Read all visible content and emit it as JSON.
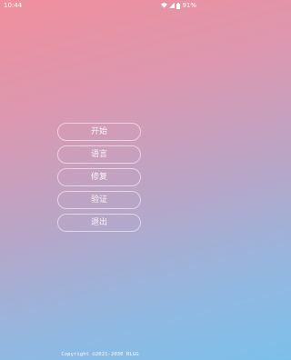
{
  "status_bar": {
    "time": "10:44",
    "battery": "91%",
    "icons": [
      "wifi-icon",
      "signal-icon",
      "battery-icon"
    ]
  },
  "menu": {
    "items": [
      {
        "label": "开始"
      },
      {
        "label": "语言"
      },
      {
        "label": "修复"
      },
      {
        "label": "验证"
      },
      {
        "label": "退出"
      }
    ]
  },
  "footer": {
    "copyright": "Copyright ©2021-2030 RLGG"
  },
  "colors": {
    "gradient_top": "#f08f9d",
    "gradient_bottom": "#7cc0ea"
  }
}
